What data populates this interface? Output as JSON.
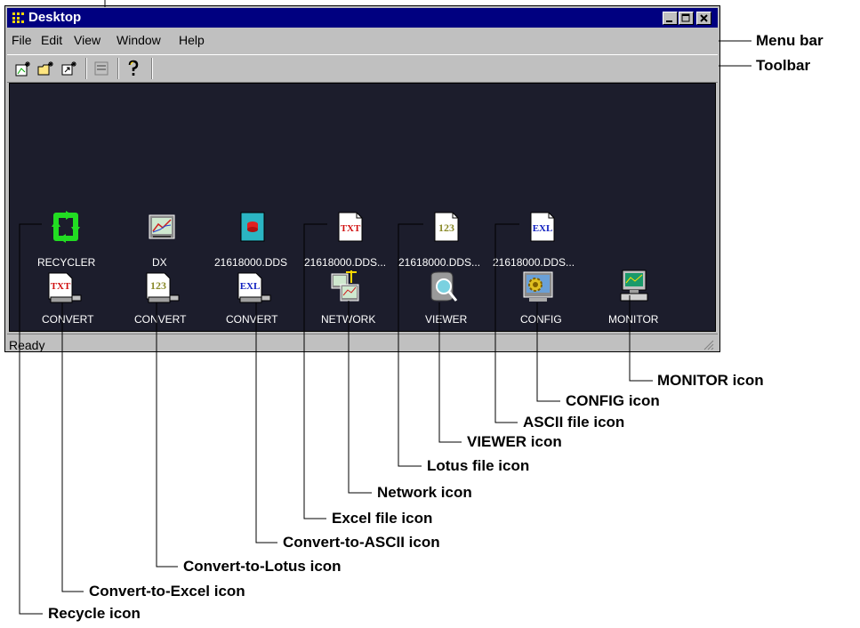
{
  "window": {
    "title": "Desktop",
    "status": "Ready",
    "menu": [
      "File",
      "Edit",
      "View",
      "Window",
      "Help"
    ]
  },
  "desktop_icons_row1": [
    {
      "id": "recycler",
      "label": "RECYCLER",
      "icon": "recycle-icon"
    },
    {
      "id": "dx",
      "label": "DX",
      "icon": "dx-icon"
    },
    {
      "id": "dds1",
      "label": "21618000.DDS",
      "icon": "dds-file-icon"
    },
    {
      "id": "txt-file",
      "label": "21618000.DDS...",
      "icon": "txt-file-icon"
    },
    {
      "id": "lotus-file",
      "label": "21618000.DDS...",
      "icon": "lotus-file-icon"
    },
    {
      "id": "excel-file",
      "label": "21618000.DDS...",
      "icon": "excel-file-icon"
    }
  ],
  "desktop_icons_row2": [
    {
      "id": "convert-txt",
      "label": "CONVERT",
      "icon": "convert-txt-icon"
    },
    {
      "id": "convert-123",
      "label": "CONVERT",
      "icon": "convert-lotus-icon"
    },
    {
      "id": "convert-exl",
      "label": "CONVERT",
      "icon": "convert-excel-icon"
    },
    {
      "id": "network",
      "label": "NETWORK",
      "icon": "network-icon"
    },
    {
      "id": "viewer",
      "label": "VIEWER",
      "icon": "viewer-icon"
    },
    {
      "id": "config",
      "label": "CONFIG",
      "icon": "config-icon"
    },
    {
      "id": "monitor",
      "label": "MONITOR",
      "icon": "monitor-icon"
    }
  ],
  "icon_text": {
    "txt": "TXT",
    "lotus": "123",
    "excel": "EXL"
  },
  "callouts": {
    "menu_bar": "Menu bar",
    "toolbar": "Toolbar",
    "monitor": "MONITOR icon",
    "config": "CONFIG icon",
    "ascii_file": "ASCII file icon",
    "viewer": "VIEWER icon",
    "lotus_file": "Lotus file icon",
    "network": "Network icon",
    "excel_file": "Excel file icon",
    "convert_ascii": "Convert-to-ASCII icon",
    "convert_lotus": "Convert-to-Lotus icon",
    "convert_excel": "Convert-to-Excel icon",
    "recycle": "Recycle icon"
  },
  "colors": {
    "titlebar": "#000080",
    "desktop_bg": "#1c1d2c",
    "chrome": "#c0c0c0",
    "recycle_green": "#22dd22"
  }
}
